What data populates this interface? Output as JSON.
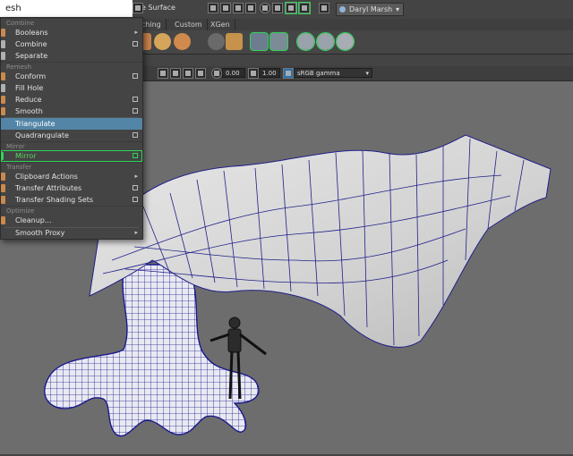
{
  "status_line": {
    "menu_search_value": "esh",
    "make_live_label": "e Surface",
    "account_name": "Daryl Marsh",
    "account_caret": "▾"
  },
  "shelf_tabs": [
    "aching",
    "Custom",
    "XGen"
  ],
  "panel_toolbar": {
    "field_a": "0.00",
    "field_b": "1.00",
    "color_space": "sRGB gamma",
    "color_space_caret": "▾"
  },
  "menu": {
    "sections": {
      "combine": "Combine",
      "remesh": "Remesh",
      "mirror": "Mirror",
      "transfer": "Transfer",
      "optimize": "Optimize"
    },
    "items": {
      "booleans": "Booleans",
      "combine": "Combine",
      "separate": "Separate",
      "conform": "Conform",
      "fill_hole": "Fill Hole",
      "reduce": "Reduce",
      "smooth": "Smooth",
      "triangulate": "Triangulate",
      "quadrangulate": "Quadrangulate",
      "mirror": "Mirror",
      "clipboard_actions": "Clipboard Actions",
      "transfer_attributes": "Transfer Attributes",
      "transfer_shading_sets": "Transfer Shading Sets",
      "cleanup": "Cleanup...",
      "smooth_proxy": "Smooth Proxy"
    },
    "submenu_arrow": "▸"
  },
  "colors": {
    "viewport_bg": "#6d6d6d",
    "wireframe": "#1a1a8c",
    "selection": "#5285a6",
    "highlight_green": "#2fd65a"
  }
}
